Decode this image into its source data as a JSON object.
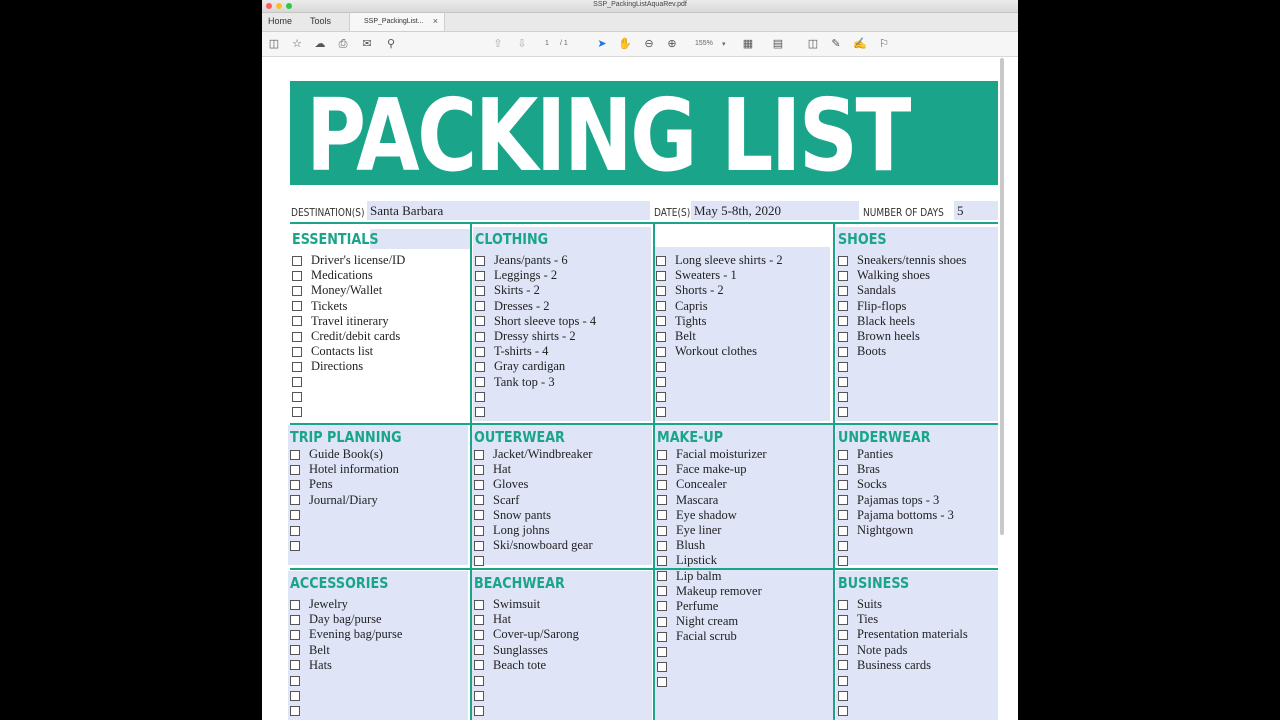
{
  "window": {
    "title": "SSP_PackingListAquaRev.pdf"
  },
  "tabs": {
    "home": "Home",
    "tools": "Tools",
    "document": "SSP_PackingList...",
    "close": "×"
  },
  "toolbar": {
    "page_current": "1",
    "page_total": "/ 1",
    "zoom": "155%"
  },
  "document": {
    "title": "PACKING LIST",
    "destination_label": "DESTINATION(S)",
    "destination": "Santa Barbara",
    "dates_label": "DATE(S)",
    "dates": "May 5-8th, 2020",
    "days_label": "NUMBER OF DAYS",
    "days": "5",
    "sections": [
      {
        "title": "ESSENTIALS",
        "items": [
          "Driver's license/ID",
          "Medications",
          "Money/Wallet",
          "Tickets",
          "Travel itinerary",
          "Credit/debit cards",
          "Contacts list",
          "Directions",
          "",
          "",
          ""
        ]
      },
      {
        "title": "CLOTHING",
        "items": [
          "Jeans/pants - 6",
          "Leggings - 2",
          "Skirts - 2",
          "Dresses - 2",
          "Short sleeve tops - 4",
          "Dressy shirts - 2",
          "T-shirts - 4",
          "Gray cardigan",
          "Tank top - 3",
          "",
          ""
        ]
      },
      {
        "title": "",
        "items": [
          "Long sleeve shirts - 2",
          "Sweaters - 1",
          "Shorts - 2",
          "Capris",
          "Tights",
          "Belt",
          "Workout clothes",
          "",
          "",
          "",
          ""
        ]
      },
      {
        "title": "SHOES",
        "items": [
          "Sneakers/tennis shoes",
          "Walking shoes",
          "Sandals",
          "Flip-flops",
          "Black heels",
          "Brown heels",
          "Boots",
          "",
          "",
          "",
          ""
        ]
      },
      {
        "title": "TRIP PLANNING",
        "items": [
          "Guide Book(s)",
          "Hotel information",
          "Pens",
          "Journal/Diary",
          "",
          "",
          ""
        ]
      },
      {
        "title": "OUTERWEAR",
        "items": [
          "Jacket/Windbreaker",
          "Hat",
          "Gloves",
          "Scarf",
          "Snow pants",
          "Long johns",
          "Ski/snowboard gear",
          ""
        ]
      },
      {
        "title": "MAKE-UP",
        "items": [
          "Facial moisturizer",
          "Face make-up",
          "Concealer",
          "Mascara",
          "Eye shadow",
          "Eye liner",
          "Blush",
          "Lipstick",
          "Lip balm",
          "Makeup remover",
          "Perfume",
          "Night cream",
          "Facial scrub",
          "",
          "",
          ""
        ]
      },
      {
        "title": "UNDERWEAR",
        "items": [
          "Panties",
          "Bras",
          "Socks",
          "Pajamas tops - 3",
          "Pajama bottoms - 3",
          "Nightgown",
          "",
          ""
        ]
      },
      {
        "title": "ACCESSORIES",
        "items": [
          "Jewelry",
          "Day bag/purse",
          "Evening bag/purse",
          "Belt",
          "Hats",
          "",
          "",
          ""
        ]
      },
      {
        "title": "BEACHWEAR",
        "items": [
          "Swimsuit",
          "Hat",
          "Cover-up/Sarong",
          "Sunglasses",
          "Beach tote",
          "",
          "",
          ""
        ]
      },
      {
        "title": "BUSINESS",
        "items": [
          "Suits",
          "Ties",
          "Presentation materials",
          "Note pads",
          "Business cards",
          "",
          "",
          ""
        ]
      }
    ]
  }
}
